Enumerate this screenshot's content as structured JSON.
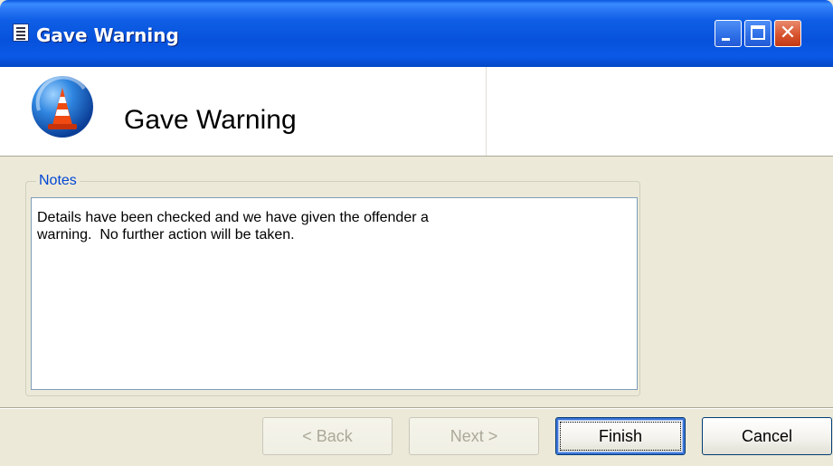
{
  "window": {
    "title": "Gave Warning",
    "controls": {
      "minimize_icon": "minimize-icon",
      "maximize_icon": "maximize-icon",
      "close_icon": "close-icon"
    },
    "close_glyph": "✕",
    "titlebar_color": "#0a59e6",
    "face_color": "#ece9d8"
  },
  "header": {
    "title": "Gave Warning",
    "icon": "traffic-cone-icon"
  },
  "notes": {
    "label": "Notes",
    "text": "Details have been checked and we have given the offender a\nwarning.  No further action will be taken."
  },
  "buttons": {
    "back": "< Back",
    "next": "Next >",
    "finish": "Finish",
    "cancel": "Cancel"
  },
  "states": {
    "back_enabled": false,
    "next_enabled": false,
    "default_button": "finish"
  }
}
